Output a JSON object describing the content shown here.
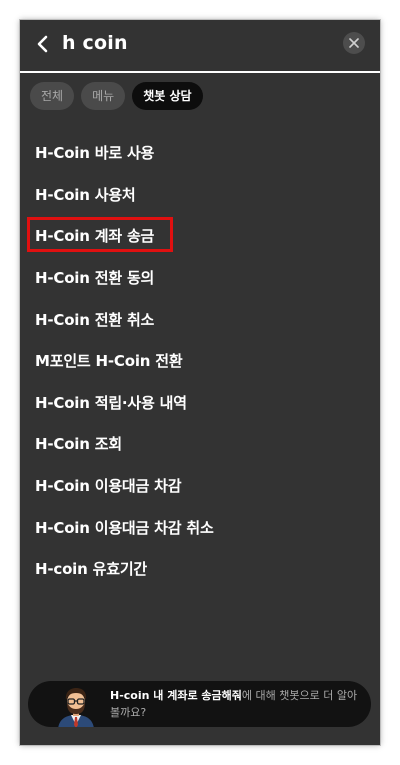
{
  "header": {
    "search_query": "h coin",
    "back_icon": "chevron-left-icon",
    "close_icon": "close-icon"
  },
  "tabs": [
    {
      "label": "전체",
      "active": false
    },
    {
      "label": "메뉴",
      "active": false
    },
    {
      "label": "챗봇 상담",
      "active": true
    }
  ],
  "results": [
    "H-Coin 바로 사용",
    "H-Coin 사용처",
    "H-Coin 계좌 송금",
    "H-Coin 전환 동의",
    "H-Coin 전환 취소",
    "M포인트 H-Coin 전환",
    "H-Coin 적립·사용 내역",
    "H-Coin 조회",
    "H-Coin 이용대금 차감",
    "H-Coin 이용대금 차감 취소",
    "H-coin 유효기간"
  ],
  "chatbot": {
    "highlight": "H-coin 내 계좌로 송금해줘",
    "suffix": "에 대해 챗봇으로 더 알아볼까요?",
    "avatar_icon": "chatbot-avatar"
  },
  "colors": {
    "panel_bg": "#333333",
    "active_tab_bg": "#0d0d0d",
    "inactive_tab_bg": "#4a4a4a",
    "highlight_border": "#e01010",
    "chatbot_bar_bg": "#121212"
  }
}
